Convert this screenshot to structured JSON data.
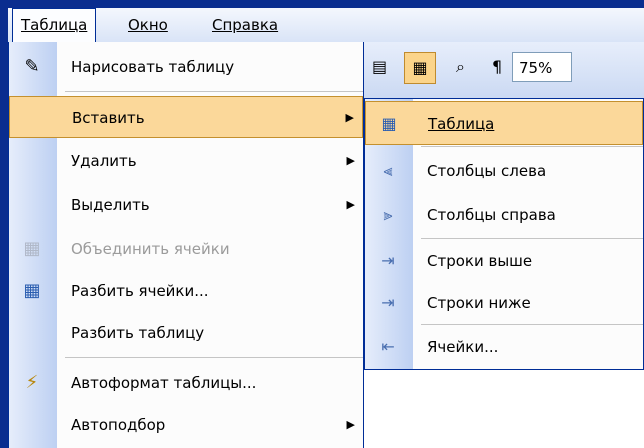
{
  "menubar": {
    "items": [
      {
        "label": "Таблица",
        "active": true
      },
      {
        "label": "Окно",
        "active": false
      },
      {
        "label": "Справка",
        "active": false
      }
    ]
  },
  "toolbar": {
    "zoom": "75%",
    "pilcrow": "¶"
  },
  "menu": {
    "items": [
      {
        "label": "Нарисовать таблицу",
        "icon": "draw-table-icon",
        "submenu": false,
        "disabled": false,
        "highlighted": false
      },
      {
        "label": "Вставить",
        "icon": "",
        "submenu": true,
        "disabled": false,
        "highlighted": true
      },
      {
        "label": "Удалить",
        "icon": "",
        "submenu": true,
        "disabled": false,
        "highlighted": false
      },
      {
        "label": "Выделить",
        "icon": "",
        "submenu": true,
        "disabled": false,
        "highlighted": false
      },
      {
        "label": "Объединить ячейки",
        "icon": "merge-cells-icon",
        "submenu": false,
        "disabled": true,
        "highlighted": false
      },
      {
        "label": "Разбить ячейки...",
        "icon": "split-cells-icon",
        "submenu": false,
        "disabled": false,
        "highlighted": false
      },
      {
        "label": "Разбить таблицу",
        "icon": "",
        "submenu": false,
        "disabled": false,
        "highlighted": false
      },
      {
        "label": "Автоформат таблицы...",
        "icon": "table-autoformat-icon",
        "submenu": false,
        "disabled": false,
        "highlighted": false
      },
      {
        "label": "Автоподбор",
        "icon": "",
        "submenu": true,
        "disabled": false,
        "highlighted": false
      }
    ]
  },
  "submenu": {
    "items": [
      {
        "label": "Таблица",
        "icon": "insert-table-icon",
        "highlighted": true
      },
      {
        "label": "Столбцы слева",
        "icon": "columns-left-icon",
        "highlighted": false
      },
      {
        "label": "Столбцы справа",
        "icon": "columns-right-icon",
        "highlighted": false
      },
      {
        "label": "Строки выше",
        "icon": "rows-above-icon",
        "highlighted": false
      },
      {
        "label": "Строки ниже",
        "icon": "rows-below-icon",
        "highlighted": false
      },
      {
        "label": "Ячейки...",
        "icon": "cells-icon",
        "highlighted": false
      }
    ]
  },
  "colors": {
    "frame": "#0a2d8f",
    "highlight": "#fbd89a",
    "highlight_border": "#c4902e",
    "menu_border": "#002d96"
  }
}
